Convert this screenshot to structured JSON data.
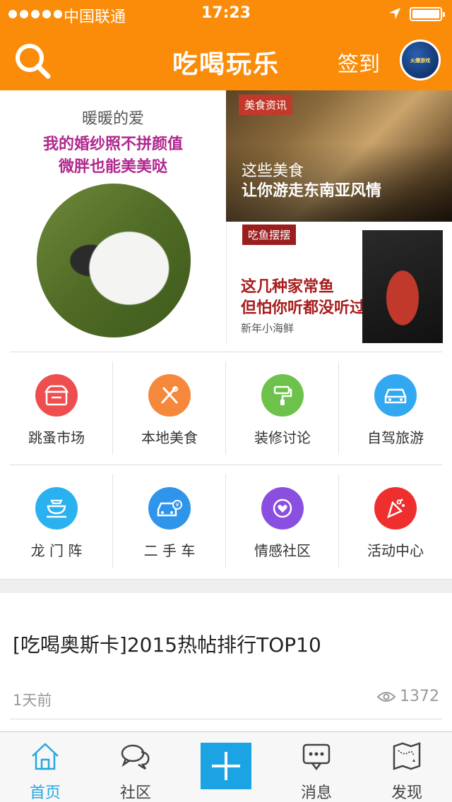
{
  "status_bar": {
    "carrier": "中国联通",
    "time": "17:23"
  },
  "header": {
    "title": "吃喝玩乐",
    "signin_label": "签到",
    "avatar_text": "火爆游戏"
  },
  "featured": {
    "left": {
      "subtitle": "暖暖的爱",
      "line1": "我的婚纱照不拼颜值",
      "line2": "微胖也能美美哒"
    },
    "right_top": {
      "tag": "美食资讯",
      "line1": "这些美食",
      "line2": "让你游走东南亚风情"
    },
    "right_bottom": {
      "tag": "吃鱼摆摆",
      "line1": "这几种家常鱼",
      "line2": "但怕你听都没听过",
      "subtitle": "新年小海鲜"
    }
  },
  "categories": [
    {
      "label": "跳蚤市场",
      "color": "#ef4e4e",
      "icon": "shop-icon"
    },
    {
      "label": "本地美食",
      "color": "#f5883a",
      "icon": "utensils-icon"
    },
    {
      "label": "装修讨论",
      "color": "#6cc24a",
      "icon": "paint-roller-icon"
    },
    {
      "label": "自驾旅游",
      "color": "#32a8f0",
      "icon": "car-icon"
    },
    {
      "label": "龙 门 阵",
      "color": "#2ab1ef",
      "icon": "teacup-icon"
    },
    {
      "label": "二 手 车",
      "color": "#2f95ea",
      "icon": "used-car-icon"
    },
    {
      "label": "情感社区",
      "color": "#8a4fe0",
      "icon": "heart-globe-icon"
    },
    {
      "label": "活动中心",
      "color": "#ef2e2e",
      "icon": "party-icon"
    }
  ],
  "post": {
    "title": "[吃喝奥斯卡]2015热帖排行TOP10",
    "time": "1天前",
    "views": "1372"
  },
  "tabbar": {
    "tabs": [
      {
        "label": "首页",
        "icon": "home-icon",
        "active": true
      },
      {
        "label": "社区",
        "icon": "chat-bubbles-icon",
        "active": false
      },
      {
        "label": "消息",
        "icon": "message-icon",
        "active": false
      },
      {
        "label": "发现",
        "icon": "map-icon",
        "active": false
      }
    ],
    "accent": "#25a8e0"
  }
}
